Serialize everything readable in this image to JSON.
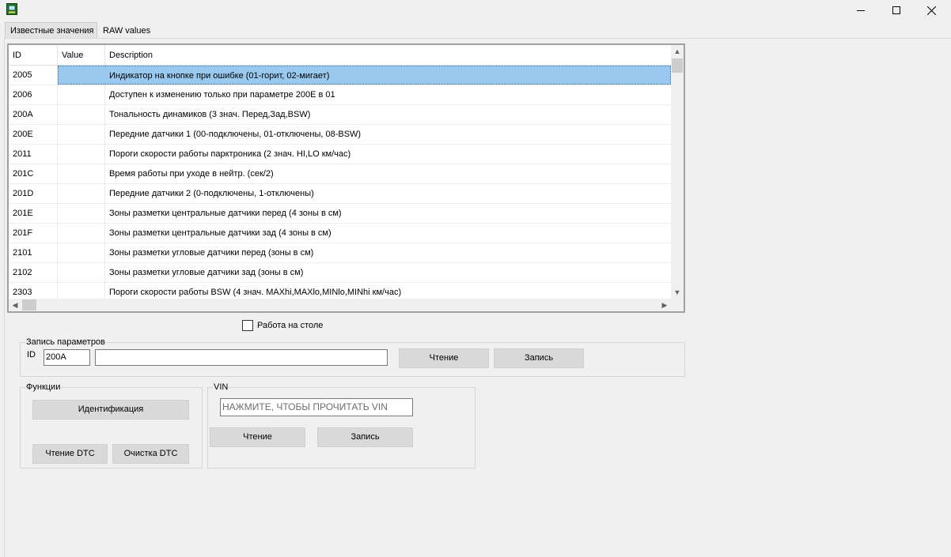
{
  "window": {
    "icon": "app-chip-icon",
    "minimize_icon": "minimize-icon",
    "maximize_icon": "maximize-icon",
    "close_icon": "close-icon"
  },
  "tabs": [
    {
      "label": "Известные значения",
      "active": true
    },
    {
      "label": "RAW values",
      "active": false
    }
  ],
  "grid": {
    "columns": [
      "ID",
      "Value",
      "Description"
    ],
    "rows": [
      {
        "id": "2005",
        "value": "",
        "description": "Индикатор на кнопке при ошибке (01-горит, 02-мигает)",
        "selected": true
      },
      {
        "id": "2006",
        "value": "",
        "description": "Доступен к изменению только при параметре 200E в 01"
      },
      {
        "id": "200A",
        "value": "",
        "description": "Тональность динамиков (3 знач. Перед,Зад,BSW)"
      },
      {
        "id": "200E",
        "value": "",
        "description": "Передние датчики 1 (00-подключены, 01-отключены, 08-BSW)"
      },
      {
        "id": "2011",
        "value": "",
        "description": "Пороги скорости работы парктроника (2 знач. HI,LO км/час)"
      },
      {
        "id": "201C",
        "value": "",
        "description": "Время работы при уходе в нейтр. (сек/2)"
      },
      {
        "id": "201D",
        "value": "",
        "description": "Передние датчики 2 (0-подключены, 1-отключены)"
      },
      {
        "id": "201E",
        "value": "",
        "description": "Зоны разметки центральные датчики перед (4 зоны в см)"
      },
      {
        "id": "201F",
        "value": "",
        "description": "Зоны разметки центральные датчики зад (4 зоны в см)"
      },
      {
        "id": "2101",
        "value": "",
        "description": "Зоны разметки угловые датчики перед (зоны в см)"
      },
      {
        "id": "2102",
        "value": "",
        "description": "Зоны разметки угловые датчики зад (зоны в см)"
      },
      {
        "id": "2303",
        "value": "",
        "description": "Пороги скорости работы BSW (4 знач. MAXhi,MAXlo,MINlo,MINhi км/час)"
      }
    ]
  },
  "desk_mode": {
    "label": "Работа на столе",
    "checked": false
  },
  "write_params": {
    "title": "Запись параметров",
    "id_label": "ID",
    "id_value": "200A",
    "value_field": "",
    "read_button": "Чтение",
    "write_button": "Запись"
  },
  "functions": {
    "title": "Функции",
    "identify_button": "Идентификация",
    "read_dtc_button": "Чтение DTC",
    "clear_dtc_button": "Очистка DTC"
  },
  "vin": {
    "title": "VIN",
    "field_value": "НАЖМИТЕ, ЧТОБЫ ПРОЧИТАТЬ VIN",
    "read_button": "Чтение",
    "write_button": "Запись"
  },
  "colors": {
    "selection": "#99c9ef",
    "button": "#d9d9d9",
    "window_bg": "#f0f0f0"
  }
}
